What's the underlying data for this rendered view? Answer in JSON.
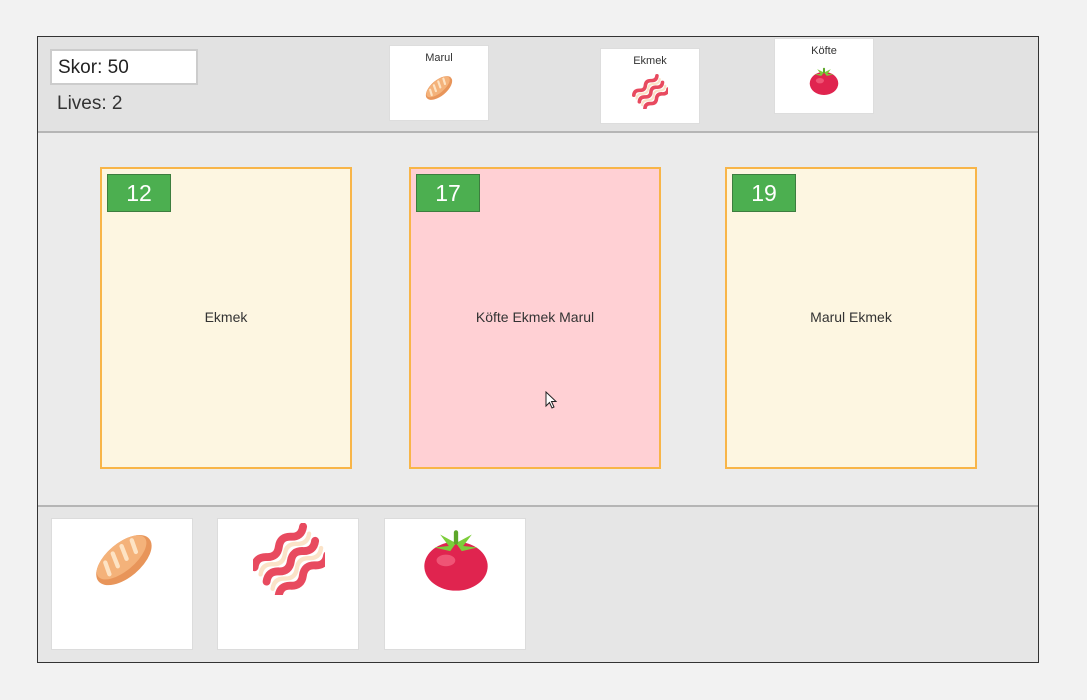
{
  "hud": {
    "score_text": "Skor: 50",
    "lives_text": "Lives: 2"
  },
  "order_chips": [
    {
      "label": "Marul",
      "icon": "bread-icon"
    },
    {
      "label": "Ekmek",
      "icon": "bacon-icon"
    },
    {
      "label": "Köfte",
      "icon": "tomato-icon"
    }
  ],
  "cards": [
    {
      "number": "12",
      "text": "Ekmek",
      "active": false
    },
    {
      "number": "17",
      "text": "Köfte Ekmek Marul",
      "active": true
    },
    {
      "number": "19",
      "text": "Marul Ekmek",
      "active": false
    }
  ],
  "tray": [
    {
      "icon": "bread-icon"
    },
    {
      "icon": "bacon-icon"
    },
    {
      "icon": "tomato-icon"
    }
  ],
  "colors": {
    "card_border": "#f8b548",
    "card_bg": "#fdf6e1",
    "card_active_bg": "#ffd0d4",
    "badge_green": "#4caf50"
  }
}
